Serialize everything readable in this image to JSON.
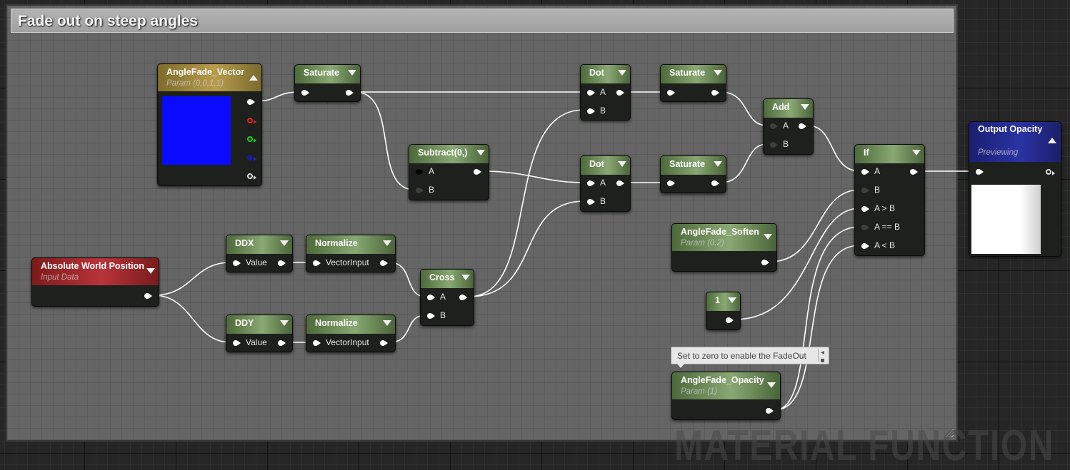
{
  "comment": {
    "title": "Fade out on steep angles"
  },
  "nodes": {
    "angle_fade_vector": {
      "title": "AngleFade_Vector",
      "subtitle": "Param (0,0,1,1)",
      "swatch_color": "#0a0aff"
    },
    "saturate_1": {
      "title": "Saturate"
    },
    "saturate_2": {
      "title": "Saturate"
    },
    "saturate_3": {
      "title": "Saturate"
    },
    "subtract": {
      "title": "Subtract(0,)",
      "pin_a": "A",
      "pin_b": "B"
    },
    "dot_1": {
      "title": "Dot",
      "pin_a": "A",
      "pin_b": "B"
    },
    "dot_2": {
      "title": "Dot",
      "pin_a": "A",
      "pin_b": "B"
    },
    "add": {
      "title": "Add",
      "pin_a": "A",
      "pin_b": "B"
    },
    "if": {
      "title": "If",
      "pins": [
        "A",
        "B",
        "A > B",
        "A == B",
        "A < B"
      ]
    },
    "output_opacity": {
      "title": "Output Opacity",
      "subtitle": "Previewing"
    },
    "absolute_world_position": {
      "title": "Absolute World Position",
      "subtitle": "Input Data"
    },
    "ddx": {
      "title": "DDX",
      "pin": "Value"
    },
    "ddy": {
      "title": "DDY",
      "pin": "Value"
    },
    "normalize_1": {
      "title": "Normalize",
      "pin": "VectorInput"
    },
    "normalize_2": {
      "title": "Normalize",
      "pin": "VectorInput"
    },
    "cross": {
      "title": "Cross",
      "pin_a": "A",
      "pin_b": "B"
    },
    "angle_fade_soften": {
      "title": "AngleFade_Soften",
      "subtitle": "Param (0.2)"
    },
    "constant_one": {
      "title": "1"
    },
    "angle_fade_opacity": {
      "title": "AngleFade_Opacity",
      "subtitle": "Param (1)"
    }
  },
  "tooltip": {
    "text": "Set to zero to enable the FadeOut"
  },
  "watermark": "MATERIAL FUNCTION"
}
